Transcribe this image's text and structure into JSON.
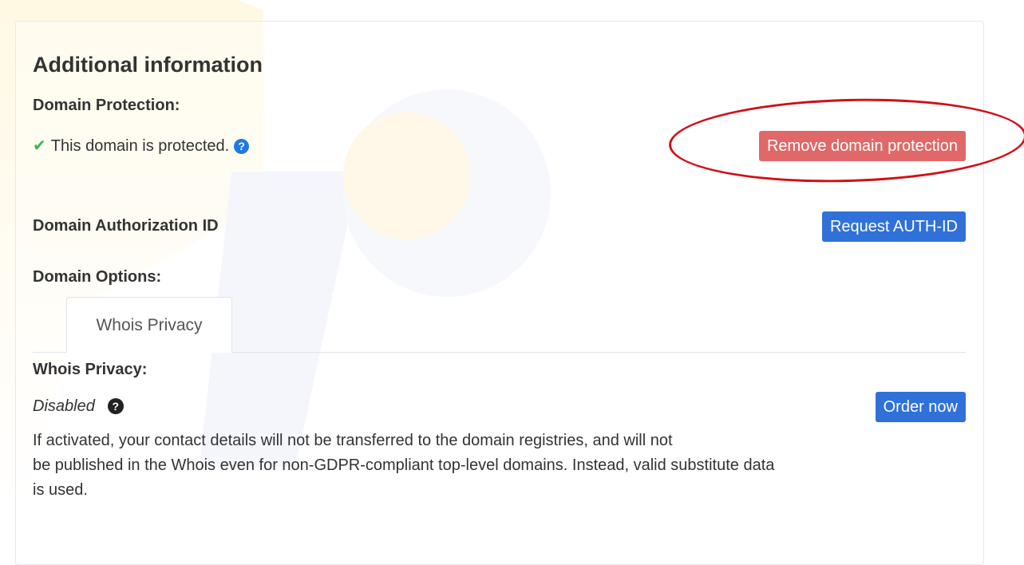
{
  "section": {
    "title": "Additional information"
  },
  "domain_protection": {
    "label": "Domain Protection:",
    "status_text": "This domain is protected.",
    "remove_button": "Remove domain protection"
  },
  "auth_id": {
    "label": "Domain Authorization ID",
    "request_button": "Request AUTH-ID"
  },
  "domain_options": {
    "label": "Domain Options:",
    "tabs": [
      {
        "label": "Whois Privacy",
        "active": true
      }
    ]
  },
  "whois_privacy": {
    "label": "Whois Privacy:",
    "status": "Disabled",
    "order_button": "Order now",
    "description_line1": "If activated, your contact details will not be transferred to the domain registries, and will not",
    "description_line2": "be published in the Whois even for non-GDPR-compliant top-level domains. Instead, valid substitute data",
    "description_line3": "is used."
  },
  "icons": {
    "check": "check-icon",
    "help_blue": "question-circle-icon",
    "help_dark": "question-circle-icon"
  },
  "colors": {
    "danger": "#e06868",
    "primary": "#2f71d9",
    "success": "#3fb34f",
    "annotation": "#d10f18"
  }
}
